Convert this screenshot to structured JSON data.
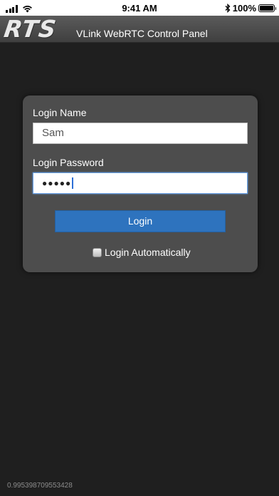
{
  "status_bar": {
    "time": "9:41 AM",
    "battery_percent": "100%",
    "battery_level": 1.0,
    "signal_icon": "signal-bars-icon",
    "wifi_icon": "wifi-icon",
    "bluetooth_icon": "bluetooth-icon"
  },
  "header": {
    "logo": "RTS",
    "title": "VLink WebRTC Control Panel"
  },
  "login": {
    "name_label": "Login Name",
    "name_value": "Sam",
    "password_label": "Login Password",
    "password_masked": "●●●●●",
    "button_label": "Login",
    "auto_label": "Login Automatically",
    "auto_checked": false
  },
  "footer": {
    "id": "0.995398709553428"
  },
  "colors": {
    "background": "#1f1f1f",
    "card": "#4d4d4d",
    "button": "#2e73be",
    "focus": "#6aa3e8"
  }
}
